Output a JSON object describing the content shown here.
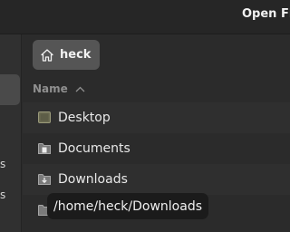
{
  "window": {
    "title": "Open Fi"
  },
  "sidebar": {
    "fragments": [
      "s",
      "s"
    ]
  },
  "location": {
    "path_button": {
      "icon": "home-icon",
      "label": "heck"
    }
  },
  "file_list": {
    "column_header": {
      "label": "Name",
      "sort": "ascending"
    },
    "rows": [
      {
        "name": "Desktop",
        "icon": "desktop-folder-icon"
      },
      {
        "name": "Documents",
        "icon": "documents-folder-icon"
      },
      {
        "name": "Downloads",
        "icon": "downloads-folder-icon"
      },
      {
        "name": "",
        "icon": "folder-icon"
      }
    ]
  },
  "tooltip": {
    "text": "/home/heck/Downloads"
  }
}
